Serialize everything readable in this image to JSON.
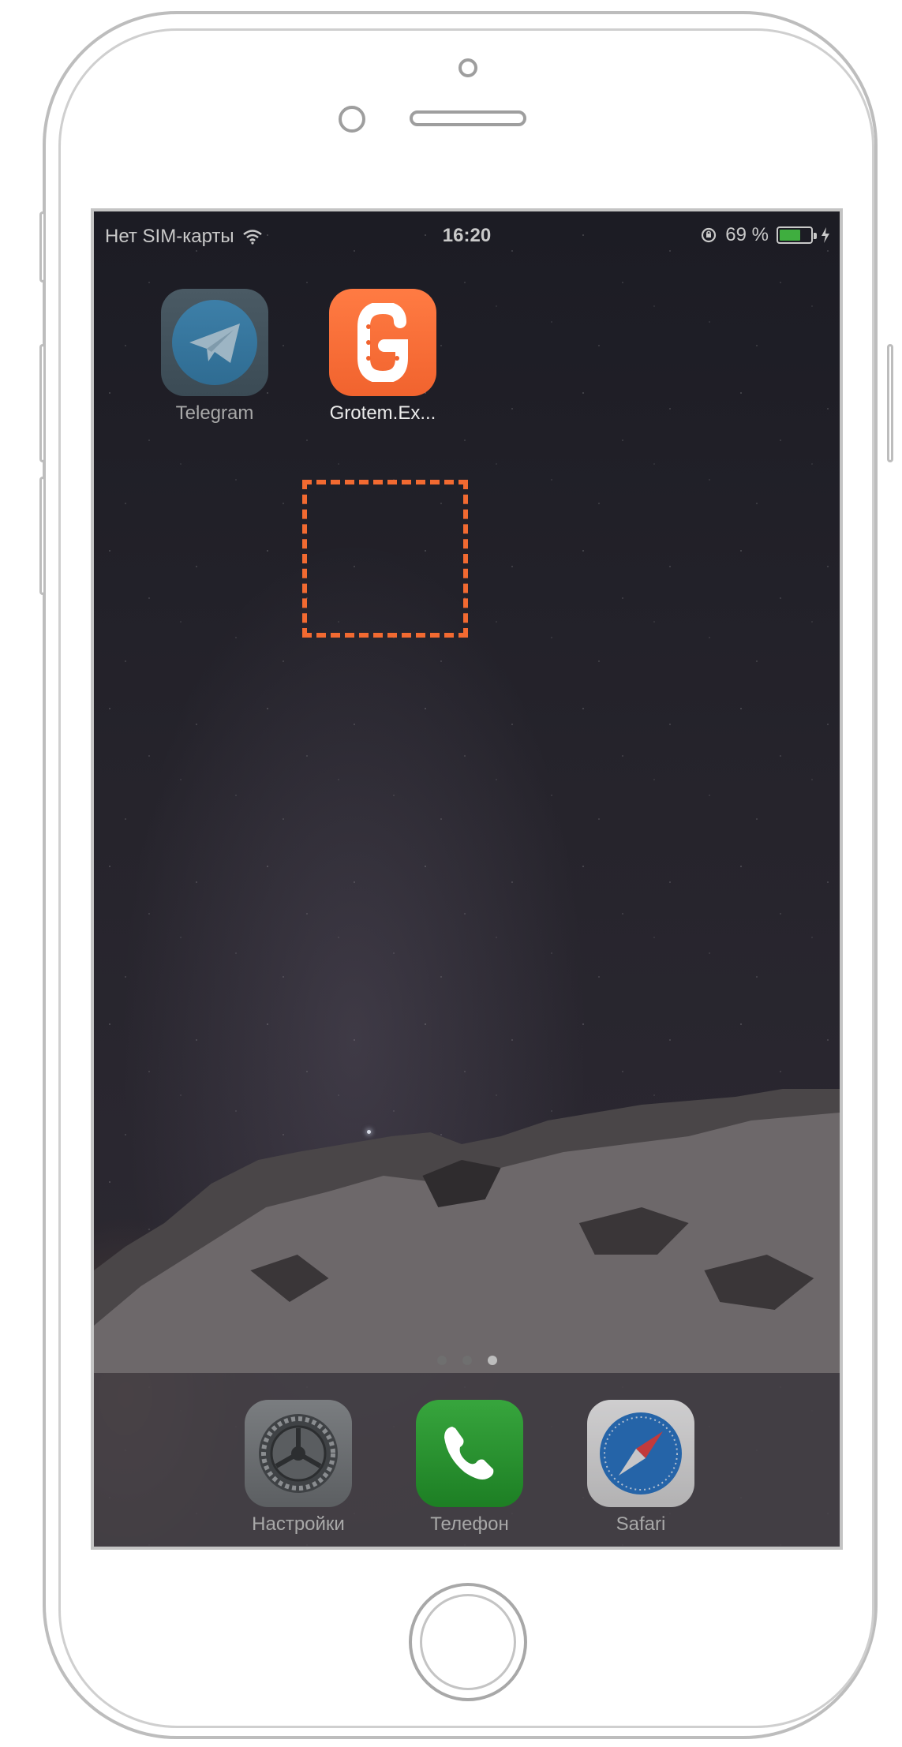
{
  "status_bar": {
    "carrier": "Нет SIM-карты",
    "time": "16:20",
    "battery_text": "69 %",
    "battery_level": 0.69,
    "battery_color": "#3fae3f"
  },
  "home_screen": {
    "apps": [
      {
        "label": "Telegram",
        "icon": "telegram-icon"
      },
      {
        "label": "Grotem.Ex...",
        "icon": "grotem-icon",
        "highlighted": true,
        "highlight_color": "#f26a31"
      }
    ],
    "page_dots": {
      "count": 3,
      "active_index": 2
    }
  },
  "dock": {
    "apps": [
      {
        "label": "Настройки",
        "icon": "settings-gear-icon"
      },
      {
        "label": "Телефон",
        "icon": "phone-handset-icon"
      },
      {
        "label": "Safari",
        "icon": "safari-compass-icon"
      }
    ]
  }
}
